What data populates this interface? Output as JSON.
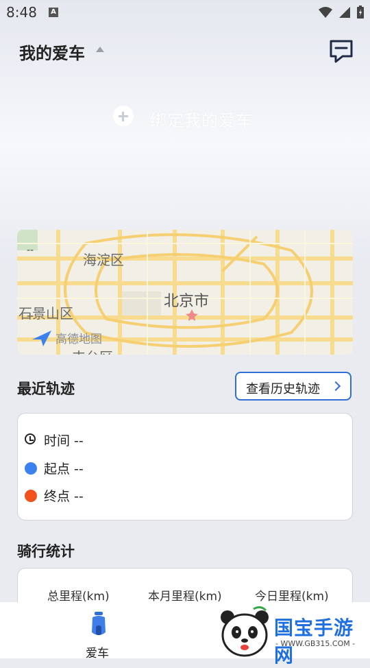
{
  "status_bar": {
    "time": "8:48",
    "notification_icon_letter": "A"
  },
  "header": {
    "title": "我的爱车"
  },
  "bind": {
    "label": "绑定我的爱车"
  },
  "map": {
    "labels": [
      "海淀区",
      "石景山区",
      "北京市",
      "高德地图",
      "丰台区"
    ],
    "placeholder_top": "--",
    "placeholder_bottom": "--"
  },
  "recent_track": {
    "title": "最近轨迹",
    "history_button": "查看历史轨迹",
    "time_label": "时间 --",
    "start_label": "起点 --",
    "end_label": "终点 --",
    "colors": {
      "start": "#3b82f0",
      "end": "#f2501d",
      "accent": "#2f6fd6"
    }
  },
  "ride_stats": {
    "title": "骑行统计",
    "columns": [
      "总里程(km)",
      "本月里程(km)",
      "今日里程(km)"
    ]
  },
  "bottom_nav": {
    "items": [
      {
        "label": "爱车",
        "icon": "scooter-icon"
      }
    ]
  },
  "watermark": {
    "title": "国宝手游网",
    "url": "- WWW.GB315.COM -"
  }
}
